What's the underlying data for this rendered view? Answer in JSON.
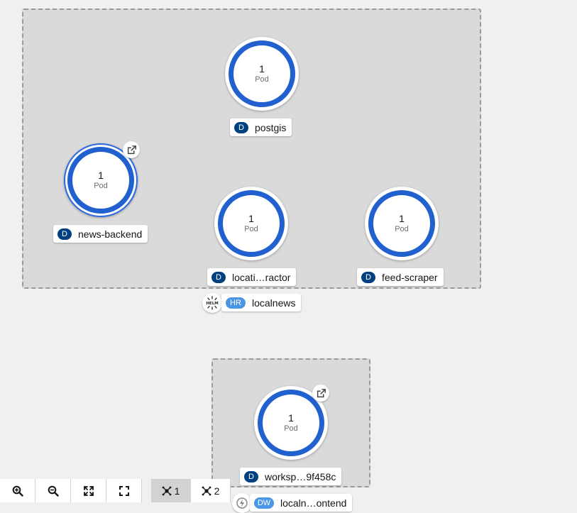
{
  "groups": [
    {
      "name": "localnews",
      "badge": "HR",
      "label": "localnews",
      "icon": "helm-icon",
      "nodes": [
        {
          "name": "postgis",
          "badge": "D",
          "count": "1",
          "unit": "Pod"
        },
        {
          "name": "news-backend",
          "badge": "D",
          "count": "1",
          "unit": "Pod",
          "selected": true,
          "external_link": true
        },
        {
          "name": "locati…ractor",
          "badge": "D",
          "count": "1",
          "unit": "Pod"
        },
        {
          "name": "feed-scraper",
          "badge": "D",
          "count": "1",
          "unit": "Pod"
        }
      ]
    },
    {
      "name": "localnews-frontend",
      "badge": "DW",
      "label": "localn…ontend",
      "icon": "devfile-icon",
      "nodes": [
        {
          "name": "worksp…9f458c",
          "badge": "D",
          "count": "1",
          "unit": "Pod",
          "external_link": true
        }
      ]
    }
  ],
  "toolbar": {
    "buttons": [
      "zoom-in-icon",
      "zoom-out-icon",
      "fit-to-screen-icon",
      "reset-view-icon"
    ],
    "layout1_label": "1",
    "layout2_label": "2",
    "active_layout": "1"
  },
  "colors": {
    "canvas": "#f0f0f0",
    "group_fill": "#dadada",
    "pod_ring": "#2160cf",
    "badge_dark": "#004080",
    "badge_light": "#4c96e6"
  }
}
